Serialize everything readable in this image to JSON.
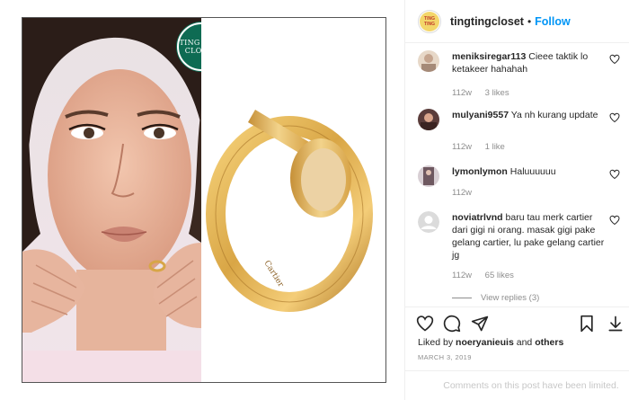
{
  "post": {
    "badge_line1": "TING TING",
    "badge_line2": "CLOSET",
    "product_engraving": "Cartier"
  },
  "header": {
    "avatar_text1": "TING",
    "avatar_text2": "TING",
    "username": "tingtingcloset",
    "separator": "•",
    "follow_label": "Follow",
    "more_label": "···"
  },
  "comments": [
    {
      "username": "meniksiregar113",
      "text": "Cieee taktik lo ketakeer hahahah",
      "age": "112w",
      "likes": "3 likes",
      "reply": ""
    },
    {
      "username": "mulyani9557",
      "text": "Ya nh kurang update",
      "age": "112w",
      "likes": "1 like",
      "reply": ""
    },
    {
      "username": "lymonlymon",
      "text": "Haluuuuuu",
      "age": "112w",
      "likes": "",
      "reply": ""
    },
    {
      "username": "noviatrlvnd",
      "text": "baru tau merk cartier dari gigi ni orang. masak gigi pake gelang cartier, lu pake gelang cartier jg",
      "age": "112w",
      "likes": "65 likes",
      "reply": ""
    }
  ],
  "view_replies": "View replies (3)",
  "likes": {
    "prefix": "Liked by",
    "user": "noeryanieuis",
    "joiner": "and",
    "others": "others"
  },
  "date": "MARCH 3, 2019",
  "limited_notice": "Comments on this post have been limited."
}
